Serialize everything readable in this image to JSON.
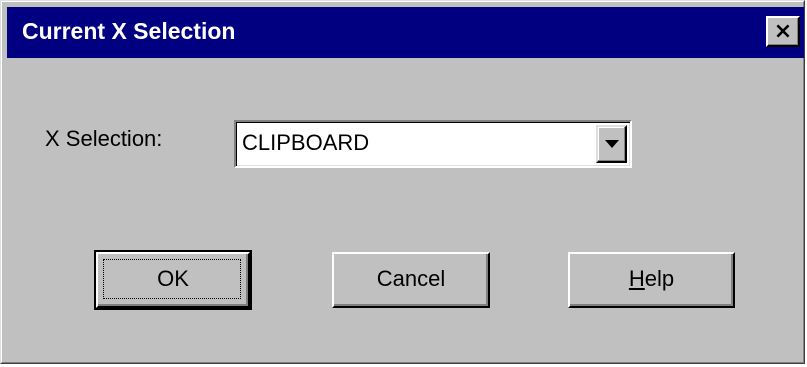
{
  "window": {
    "title": "Current X Selection",
    "close_label": "×"
  },
  "form": {
    "selection_label": "X Selection:",
    "selection_value": "CLIPBOARD"
  },
  "buttons": {
    "ok_label": "OK",
    "cancel_label": "Cancel",
    "help_mnemonic": "H",
    "help_rest": "elp"
  },
  "icons": {
    "close": "close-icon",
    "dropdown": "chevron-down-icon"
  },
  "colors": {
    "titlebar": "#000080",
    "face": "#c0c0c0",
    "field": "#ffffff"
  }
}
